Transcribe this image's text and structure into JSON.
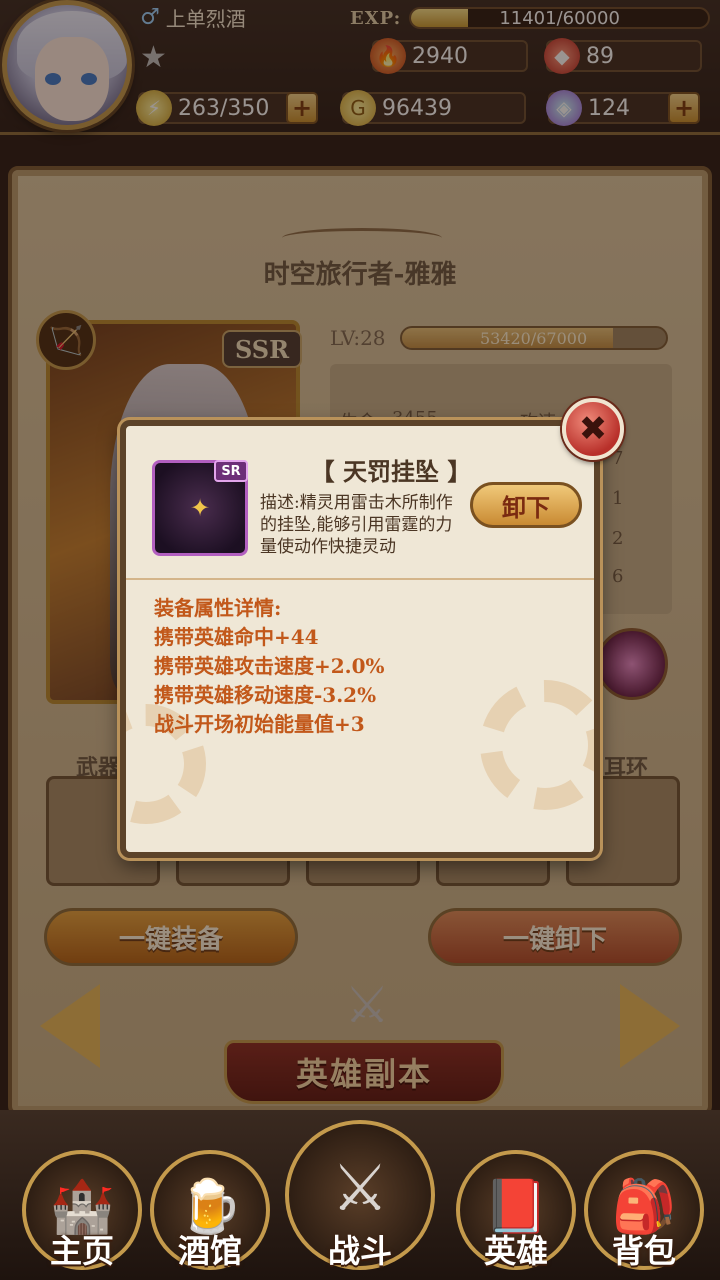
{
  "player": {
    "name": "上单烈酒",
    "gender_icon": "♂",
    "exp_label": "EXP:",
    "exp_text": "11401/60000",
    "exp_fraction": 0.19
  },
  "resources": {
    "power": "2940",
    "gems": "89",
    "energy": "263/350",
    "gold": "96439",
    "crystals": "124"
  },
  "hero": {
    "title": "时空旅行者-雅雅",
    "rarity": "SSR",
    "level": "LV:28",
    "level_exp": "53420/67000",
    "level_fraction": 0.8,
    "peek_labels": [
      "生命",
      "攻速"
    ],
    "peek_value": "3455",
    "peek_digits": [
      "7",
      "1",
      "2",
      "6"
    ],
    "slot_labels": {
      "left": "武器",
      "right": "耳环"
    }
  },
  "actions": {
    "equip_all": "一键装备",
    "unequip_all": "一键卸下",
    "dungeon": "英雄副本"
  },
  "dialog": {
    "item_name": "【 天罚挂坠 】",
    "item_rarity": "SR",
    "description": "描述:精灵用雷击木所制作的挂坠,能够引用雷霆的力量使动作快捷灵动",
    "unequip_label": "卸下",
    "attr_title": "装备属性详情:",
    "attributes": [
      "携带英雄命中+44",
      "携带英雄攻击速度+2.0%",
      "携带英雄移动速度-3.2%",
      "战斗开场初始能量值+3"
    ],
    "close_symbol": "✖"
  },
  "nav": [
    {
      "label": "主页",
      "icon": "home-icon"
    },
    {
      "label": "酒馆",
      "icon": "tavern-icon"
    },
    {
      "label": "战斗",
      "icon": "battle-icon"
    },
    {
      "label": "英雄",
      "icon": "hero-icon"
    },
    {
      "label": "背包",
      "icon": "backpack-icon"
    }
  ]
}
